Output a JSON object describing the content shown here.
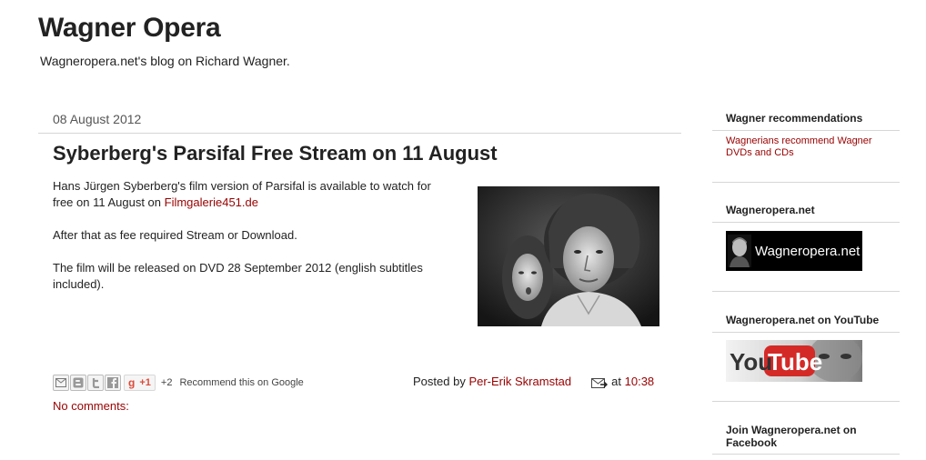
{
  "blog": {
    "title": "Wagner Opera",
    "description": "Wagneropera.net's blog on Richard Wagner."
  },
  "post": {
    "date": "08 August 2012",
    "title": "Syberberg's Parsifal Free Stream on 11 August",
    "body": {
      "p1_text": "Hans Jürgen Syberberg's film version of Parsifal is available to watch for free on 11 August on ",
      "p1_link": "Filmgalerie451.de",
      "p2": "After that as fee required Stream or Download.",
      "p3": "The film will be released on DVD 28 September 2012 (english subtitles included)."
    },
    "image_icon": "parsifal-film-still",
    "share": {
      "buttons": [
        "email-icon",
        "blogger-icon",
        "twitter-icon",
        "facebook-icon"
      ],
      "gplus_g": "g",
      "gplus_label": "+1",
      "plus_count": "+2",
      "recommend_text": "Recommend this on Google"
    },
    "footer": {
      "posted_by": "Posted by",
      "author": "Per-Erik Skramstad",
      "at": "at",
      "time": "10:38"
    },
    "comments": "No comments:"
  },
  "sidebar": {
    "recommendations": {
      "title": "Wagner recommendations",
      "link": "Wagnerians recommend Wagner DVDs and CDs"
    },
    "wagneropera": {
      "title": "Wagneropera.net",
      "badge_text": "Wagneropera.net"
    },
    "youtube": {
      "title": "Wagneropera.net on YouTube",
      "badge_text": "YouTube"
    },
    "facebook": {
      "title": "Join Wagneropera.net on Facebook"
    }
  },
  "colors": {
    "link": "#990000",
    "text": "#222222",
    "rule": "#d6d6d6"
  }
}
